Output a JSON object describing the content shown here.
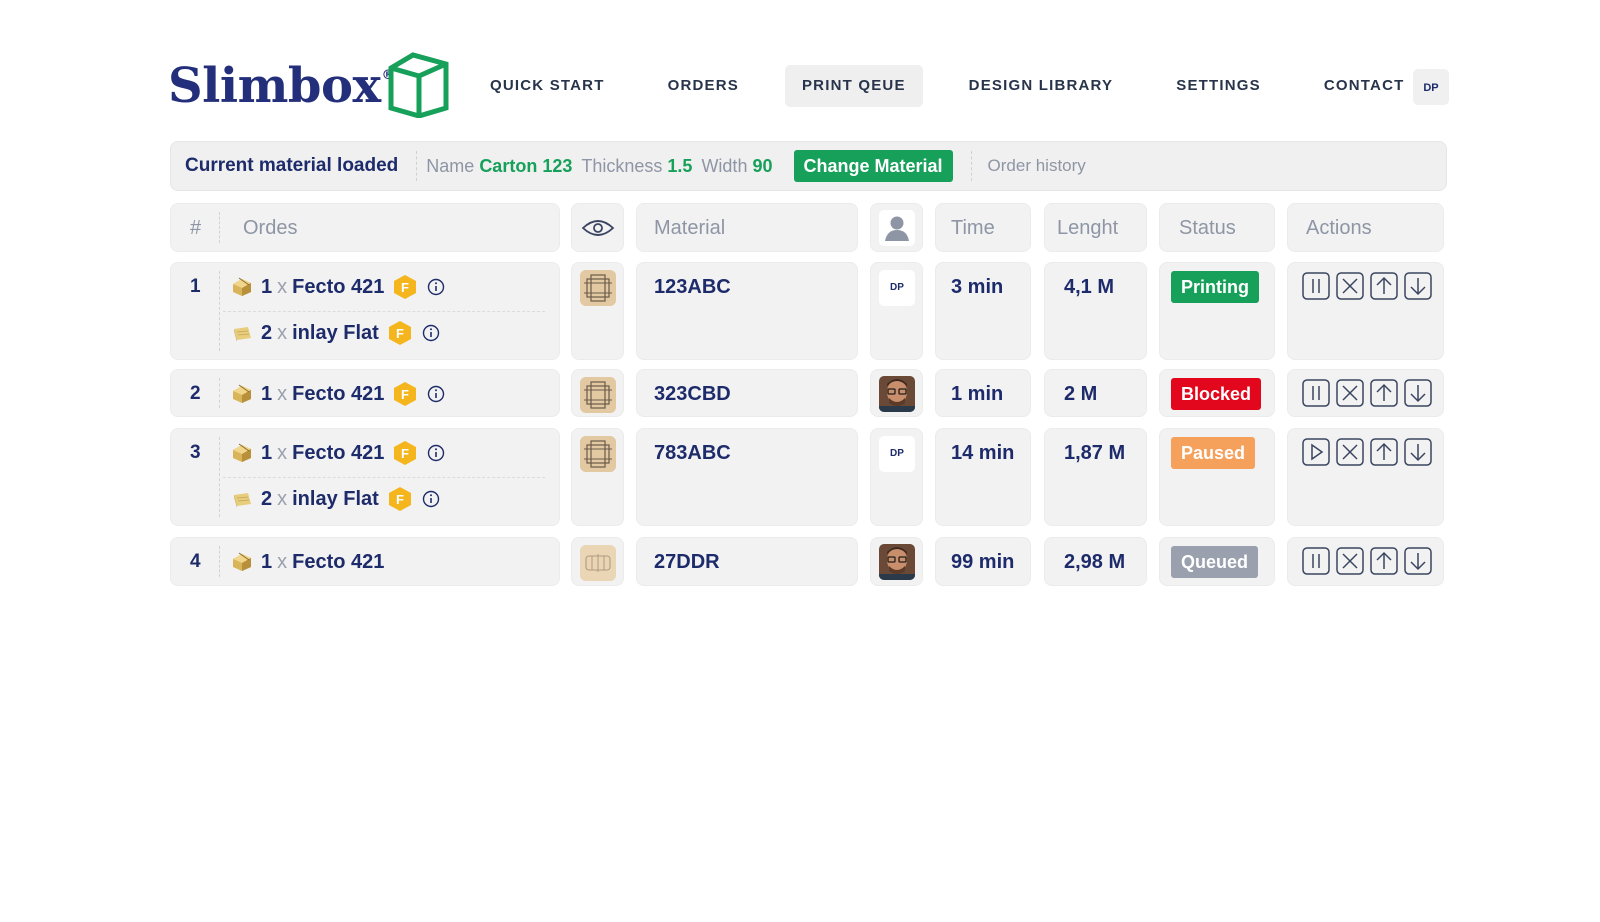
{
  "brand": {
    "name": "Slimbox",
    "registered": "®",
    "accent": "#17a05a",
    "navy": "#232f7a"
  },
  "nav": {
    "items": [
      {
        "label": "QUICK START"
      },
      {
        "label": "ORDERS"
      },
      {
        "label": "PRINT QEUE",
        "active": true
      },
      {
        "label": "DESIGN LIBRARY"
      },
      {
        "label": "SETTINGS"
      },
      {
        "label": "CONTACT"
      }
    ],
    "user_initials": "DP"
  },
  "material_bar": {
    "title": "Current material loaded",
    "name_label": "Name",
    "name_value": "Carton 123",
    "thickness_label": "Thickness",
    "thickness_value": "1.5",
    "width_label": "Width",
    "width_value": "90",
    "change_button": "Change Material",
    "history_link": "Order history"
  },
  "table": {
    "headers": {
      "index": "#",
      "orders": "Ordes",
      "preview_icon": "eye-icon",
      "material": "Material",
      "user_icon": "person-icon",
      "time": "Time",
      "length": "Lenght",
      "status": "Status",
      "actions": "Actions"
    },
    "rows": [
      {
        "index": "1",
        "items": [
          {
            "icon": "box-icon",
            "qty": "1",
            "x": "x",
            "name": "Fecto 421",
            "badge": "F",
            "info": true
          },
          {
            "icon": "inlay-icon",
            "qty": "2",
            "x": "x",
            "name": "inlay Flat",
            "badge": "F",
            "info": true
          }
        ],
        "material": "123ABC",
        "user": "DP",
        "time": "3 min",
        "length": "4,1 M",
        "status": "Printing",
        "status_color": "#17a05a",
        "first_action": "pause-icon"
      },
      {
        "index": "2",
        "items": [
          {
            "icon": "box-icon",
            "qty": "1",
            "x": "x",
            "name": "Fecto 421",
            "badge": "F",
            "info": true
          }
        ],
        "material": "323CBD",
        "user": "photo",
        "time": "1 min",
        "length": "2 M",
        "status": "Blocked",
        "status_color": "#e2071d",
        "first_action": "pause-icon"
      },
      {
        "index": "3",
        "items": [
          {
            "icon": "box-icon",
            "qty": "1",
            "x": "x",
            "name": "Fecto 421",
            "badge": "F",
            "info": true
          },
          {
            "icon": "inlay-icon",
            "qty": "2",
            "x": "x",
            "name": "inlay Flat",
            "badge": "F",
            "info": true
          }
        ],
        "material": "783ABC",
        "user": "DP",
        "time": "14 min",
        "length": "1,87 M",
        "status": "Paused",
        "status_color": "#f5a05b",
        "first_action": "play-icon"
      },
      {
        "index": "4",
        "items": [
          {
            "icon": "box-icon",
            "qty": "1",
            "x": "x",
            "name": "Fecto 421",
            "badge": "",
            "info": false
          }
        ],
        "material": "27DDR",
        "user": "photo",
        "time": "99 min",
        "length": "2,98 M",
        "status": "Queued",
        "status_color": "#9aa0ad",
        "first_action": "pause-icon"
      }
    ]
  }
}
